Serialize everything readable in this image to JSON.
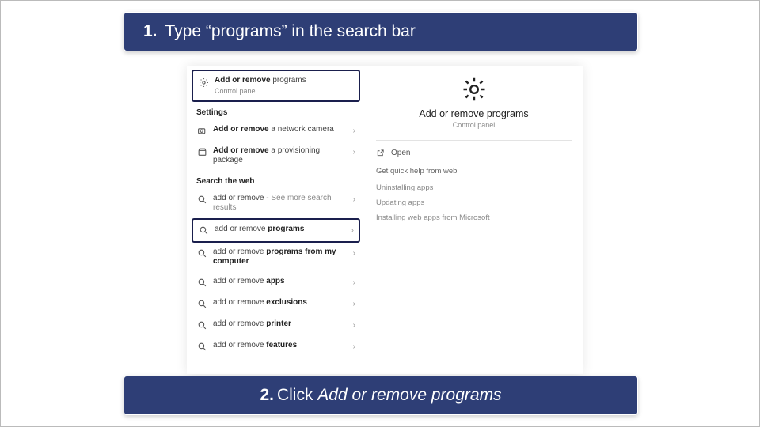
{
  "instructions": {
    "step1_num": "1.",
    "step1_text": "Type “programs” in the search bar",
    "step2_num": "2.",
    "step2_prefix": "Click ",
    "step2_action": "Add or remove programs"
  },
  "search": {
    "top_result": {
      "bold": "Add or remove",
      "rest": " programs",
      "sub": "Control panel"
    },
    "settings_label": "Settings",
    "settings_items": [
      {
        "bold": "Add or remove",
        "rest": " a network camera"
      },
      {
        "bold": "Add or remove",
        "rest": " a provisioning package"
      }
    ],
    "web_label": "Search the web",
    "web_items": [
      {
        "prefix": "add or remove",
        "bold": "",
        "suffix": " - See more search results"
      },
      {
        "prefix": "add or remove ",
        "bold": "programs",
        "suffix": ""
      },
      {
        "prefix": "add or remove ",
        "bold": "programs from my computer",
        "suffix": ""
      },
      {
        "prefix": "add or remove ",
        "bold": "apps",
        "suffix": ""
      },
      {
        "prefix": "add or remove ",
        "bold": "exclusions",
        "suffix": ""
      },
      {
        "prefix": "add or remove ",
        "bold": "printer",
        "suffix": ""
      },
      {
        "prefix": "add or remove ",
        "bold": "features",
        "suffix": ""
      }
    ]
  },
  "detail": {
    "title": "Add or remove programs",
    "sub": "Control panel",
    "open": "Open",
    "help_label": "Get quick help from web",
    "links": [
      "Uninstalling apps",
      "Updating apps",
      "Installing web apps from Microsoft"
    ]
  }
}
